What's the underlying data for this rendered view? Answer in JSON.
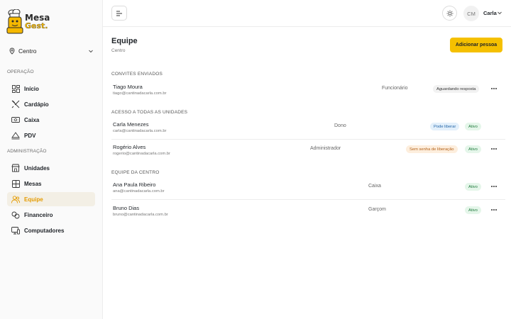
{
  "brand": {
    "line1": "Mesa",
    "line2": "Gest."
  },
  "unit_selector": {
    "value": "Centro"
  },
  "sidebar": {
    "sections": [
      {
        "title": "OPERAÇÃO",
        "items": [
          {
            "label": "Início",
            "icon": "dashboard-icon"
          },
          {
            "label": "Cardápio",
            "icon": "utensils-icon"
          },
          {
            "label": "Caixa",
            "icon": "cash-icon"
          },
          {
            "label": "PDV",
            "icon": "pos-icon"
          }
        ]
      },
      {
        "title": "ADMINISTRAÇÃO",
        "items": [
          {
            "label": "Unidades",
            "icon": "store-icon"
          },
          {
            "label": "Mesas",
            "icon": "grid-icon"
          },
          {
            "label": "Equipe",
            "icon": "users-icon",
            "active": true
          },
          {
            "label": "Financeiro",
            "icon": "coins-icon"
          },
          {
            "label": "Computadores",
            "icon": "monitor-icon"
          }
        ]
      }
    ]
  },
  "topbar": {
    "avatar_initials": "CM",
    "user_name": "Carla"
  },
  "page": {
    "title": "Equipe",
    "subtitle": "Centro",
    "add_button": "Adicionar pessoa"
  },
  "groups": [
    {
      "title": "CONVITES ENVIADOS",
      "rows": [
        {
          "name": "Tiago Moura",
          "email": "tiago@cantinadacarla.com.br",
          "role": "Funcionário",
          "badges": [
            "Aguardando resposta"
          ],
          "menu": true
        }
      ]
    },
    {
      "title": "ACESSO A TODAS AS UNIDADES",
      "rows": [
        {
          "name": "Carla Menezes",
          "email": "carla@cantinadacarla.com.br",
          "role": "Dono",
          "badges": [
            "Pode liberar",
            "Ativo"
          ],
          "menu": false
        },
        {
          "name": "Rogério Alves",
          "email": "rogerio@cantinadacarla.com.br",
          "role": "Administrador",
          "badges": [
            "Sem senha de liberação",
            "Ativo"
          ],
          "menu": true
        }
      ]
    },
    {
      "title": "EQUIPE DA CENTRO",
      "rows": [
        {
          "name": "Ana Paula Ribeiro",
          "email": "ana@cantinadacarla.com.br",
          "role": "Caixa",
          "badges": [
            "Ativo"
          ],
          "menu": true
        },
        {
          "name": "Bruno Dias",
          "email": "bruno@cantinadacarla.com.br",
          "role": "Garçom",
          "badges": [
            "Ativo"
          ],
          "menu": true
        }
      ]
    }
  ],
  "colors": {
    "accent": "#f5c000",
    "active_text": "#e59b00",
    "active_bg": "#f3efe5"
  }
}
